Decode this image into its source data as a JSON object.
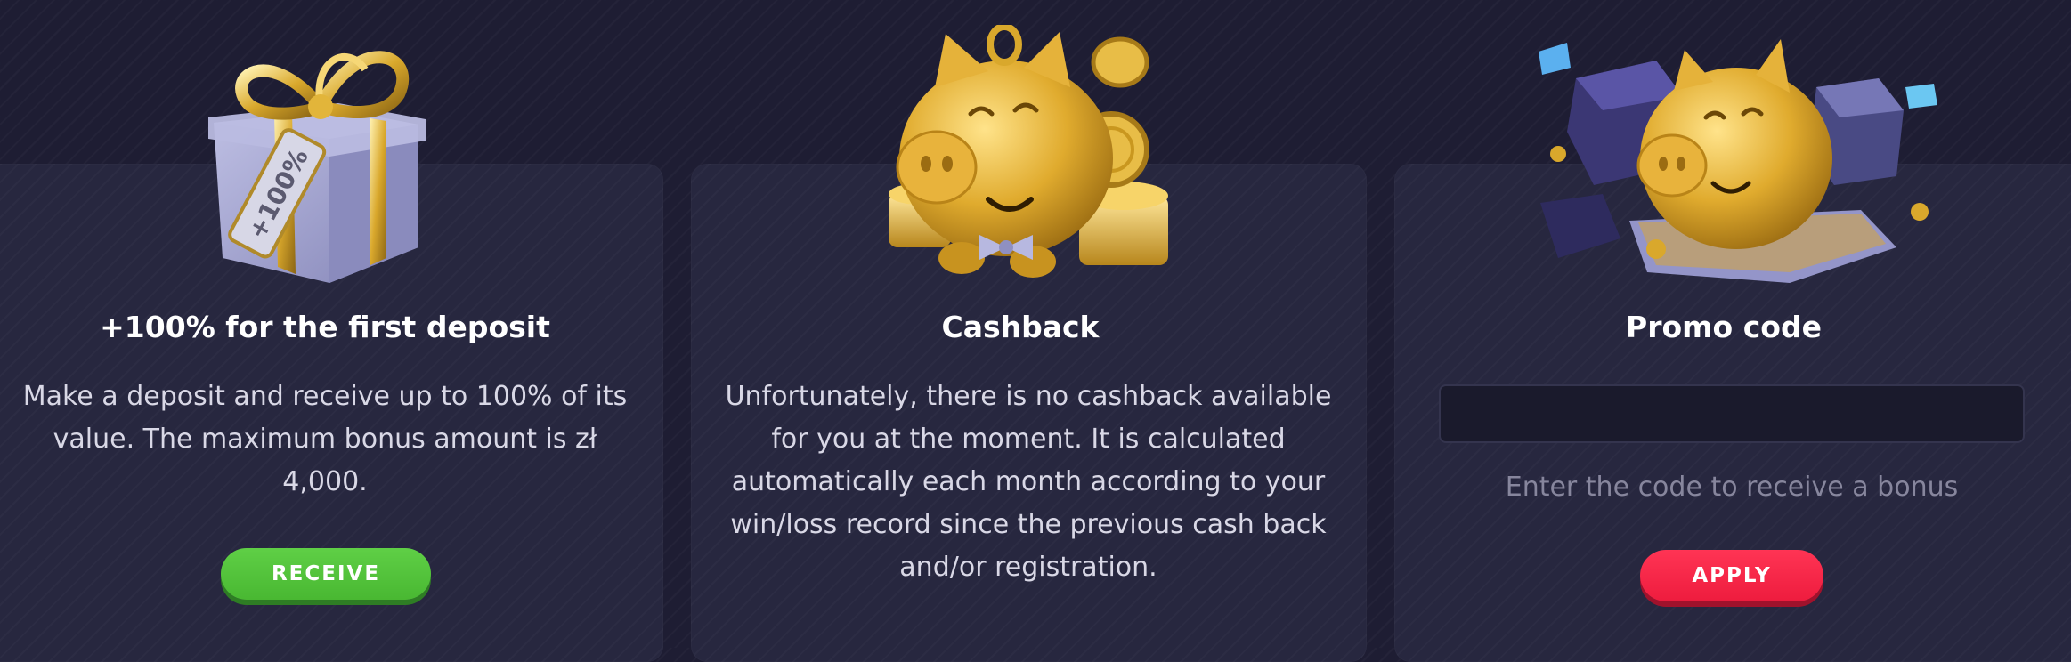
{
  "bonus_cards": [
    {
      "illustration": "gift-box-icon",
      "tag_text": "+100%",
      "title": "+100% for the first deposit",
      "description": "Make a deposit and receive up to 100% of its value. The maximum bonus amount is zł 4,000.",
      "button_label": "RECEIVE",
      "button_color": "#55c53d"
    },
    {
      "illustration": "piggy-bank-coins-icon",
      "title": "Cashback",
      "description": "Unfortunately, there is no cashback available for you at the moment. It is calculated automatically each month according to your win/loss record since the previous cash back and/or registration."
    },
    {
      "illustration": "piggy-bank-gifts-icon",
      "title": "Promo code",
      "input_value": "",
      "hint": "Enter the code to receive a bonus",
      "button_label": "APPLY",
      "button_color": "#ff2a4c"
    }
  ],
  "colors": {
    "background": "#1e1d33",
    "card": "#27273f",
    "gold": "#e3b43a",
    "gift": "#a9aad2"
  }
}
